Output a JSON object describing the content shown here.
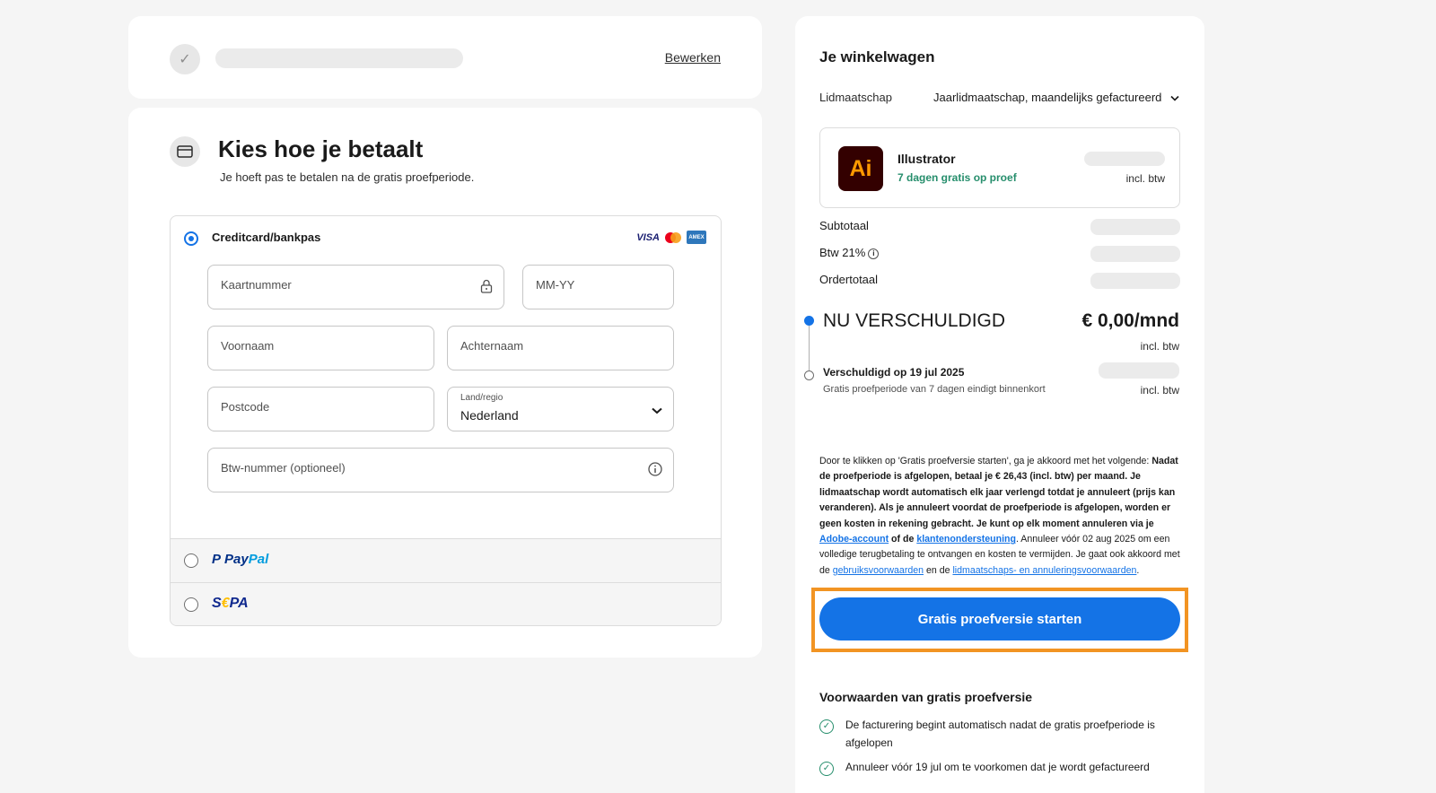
{
  "step": {
    "edit_label": "Bewerken"
  },
  "payment": {
    "title": "Kies hoe je betaalt",
    "subtitle": "Je hoeft pas te betalen na de gratis proefperiode.",
    "credit_card_label": "Creditcard/bankpas",
    "brands": {
      "visa": "VISA",
      "amex": "AMEX"
    },
    "fields": {
      "card_number": "Kaartnummer",
      "expiry": "MM-YY",
      "first_name": "Voornaam",
      "last_name": "Achternaam",
      "postcode": "Postcode",
      "country_label": "Land/regio",
      "country_value": "Nederland",
      "vat": "Btw-nummer (optioneel)"
    },
    "paypal": {
      "pay": "Pay",
      "pal": "Pal"
    },
    "sepa": {
      "s": "S",
      "e": "€",
      "pa": "PA"
    }
  },
  "cart": {
    "title": "Je winkelwagen",
    "membership_label": "Lidmaatschap",
    "membership_value": "Jaarlidmaatschap, maandelijks gefactureerd",
    "product": {
      "logo": "Ai",
      "name": "Illustrator",
      "trial": "7 dagen gratis op proef",
      "incl": "incl. btw"
    },
    "subtotal_label": "Subtotaal",
    "vat_label": "Btw 21%",
    "order_total_label": "Ordertotaal",
    "now_due_label": "NU VERSCHULDIGD",
    "now_due_price": "€ 0,00/mnd",
    "now_due_incl": "incl. btw",
    "later_due_label": "Verschuldigd op 19 jul 2025",
    "later_due_sub": "Gratis proefperiode van 7 dagen eindigt binnenkort",
    "later_due_incl": "incl. btw",
    "legal": {
      "p1": "Door te klikken op 'Gratis proefversie starten', ga je akkoord met het volgende: ",
      "b1": "Nadat de proefperiode is afgelopen, betaal je € 26,43 (incl. btw) per maand. Je lidmaatschap wordt automatisch elk jaar verlengd totdat je annuleert (prijs kan veranderen). Als je annuleert voordat de proefperiode is afgelopen, worden er geen kosten in rekening gebracht. Je kunt op elk moment annuleren via je ",
      "link_account": "Adobe-account",
      "of_de": " of de ",
      "link_support": "klantenondersteuning",
      "p2": ". Annuleer vóór 02 aug 2025 om een volledige terugbetaling te ontvangen en kosten te vermijden. Je gaat ook akkoord met de ",
      "link_terms": "gebruiksvoorwaarden",
      "en_de": " en de ",
      "link_cancel": "lidmaatschaps- en annuleringsvoorwaarden",
      "end": "."
    },
    "cta_label": "Gratis proefversie starten",
    "terms_title": "Voorwaarden van gratis proefversie",
    "terms": [
      "De facturering begint automatisch nadat de gratis proefperiode is afgelopen",
      "Annuleer vóór 19 jul om te voorkomen dat je wordt gefactureerd"
    ]
  }
}
